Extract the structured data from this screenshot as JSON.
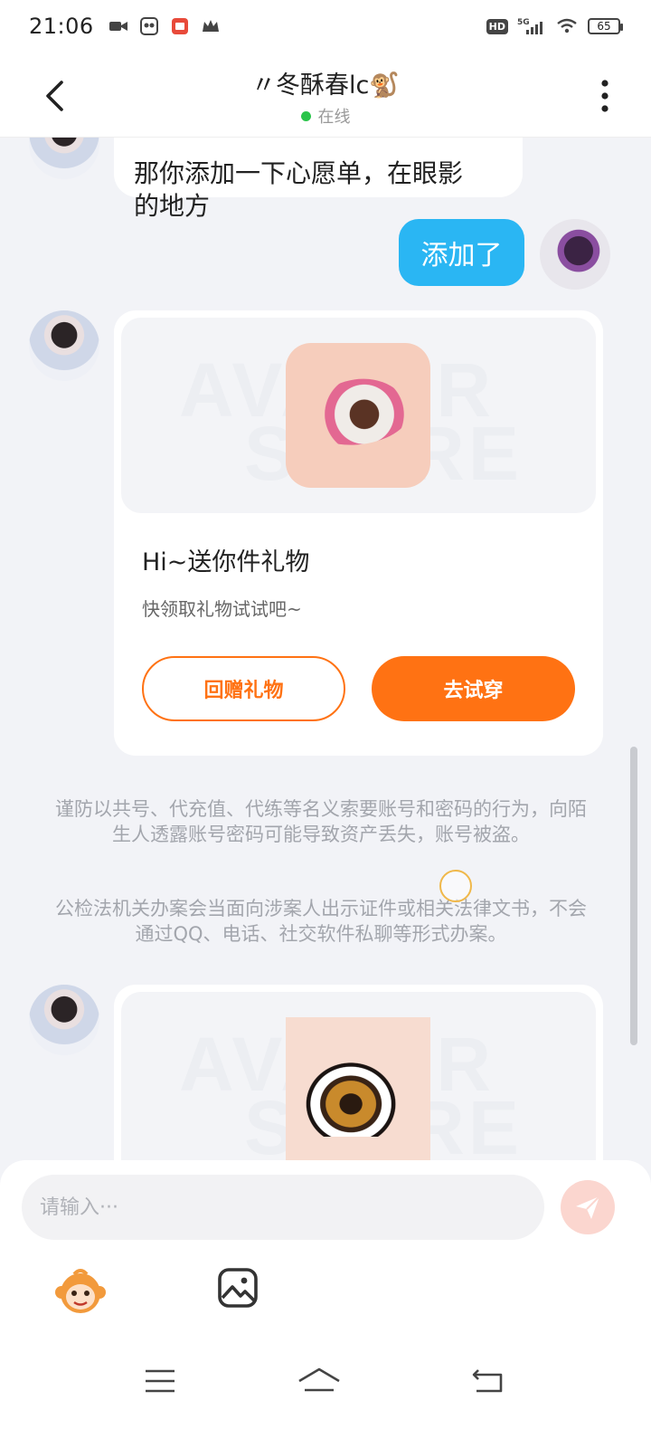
{
  "status_bar": {
    "time": "21:06",
    "battery": "65",
    "network": "5G",
    "hd": "HD"
  },
  "header": {
    "title": "〃冬酥春lc🐒",
    "status": "在线"
  },
  "messages": {
    "first_partial": "那你添加一下心愿单，在眼影\n的地方",
    "outgoing": "添加了"
  },
  "gift_card": {
    "title": "Hi~送你件礼物",
    "subtitle": "快领取礼物试试吧~",
    "return_button": "回赠礼物",
    "try_button": "去试穿",
    "watermark_top": "AVATAR",
    "watermark_bottom": "STORE"
  },
  "notices": {
    "account_warning": "谨防以共号、代充值、代练等名义索要账号和密码的行为，向陌生人透露账号密码可能导致资产丢失，账号被盗。",
    "police_warning": "公检法机关办案会当面向涉案人出示证件或相关法律文书，不会通过QQ、电话、社交软件私聊等形式办案。"
  },
  "input": {
    "placeholder": "请输入···"
  },
  "colors": {
    "accent_orange": "#ff7213",
    "bubble_blue": "#2ab6f3",
    "online_green": "#2ac44a"
  },
  "icons": {
    "back": "chevron-left-icon",
    "more": "more-vertical-icon",
    "send": "send-icon",
    "emoji": "monkey-emoji-icon",
    "image": "image-icon",
    "nav_menu": "menu-icon",
    "nav_home": "home-icon",
    "nav_back": "back-icon"
  }
}
